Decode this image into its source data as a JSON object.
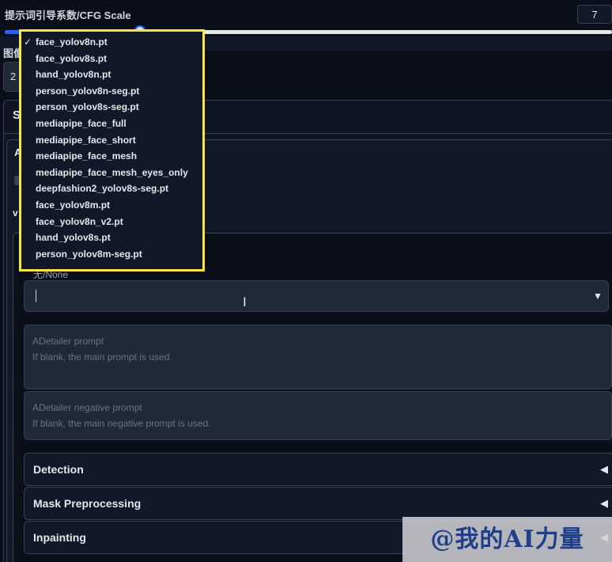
{
  "cfg": {
    "label": "提示词引导系数/CFG Scale",
    "value": "7",
    "fraction": 0.23
  },
  "partial": {
    "label": "图像",
    "box_text": "2",
    "tab": "S",
    "inner_a": "A",
    "inner_v": "v"
  },
  "model": {
    "none_label": "无/None",
    "selected": ""
  },
  "dropdown": {
    "checkmark": "✓",
    "items": [
      "face_yolov8n.pt",
      "face_yolov8s.pt",
      "hand_yolov8n.pt",
      "person_yolov8n-seg.pt",
      "person_yolov8s-seg.pt",
      "mediapipe_face_full",
      "mediapipe_face_short",
      "mediapipe_face_mesh",
      "mediapipe_face_mesh_eyes_only",
      "deepfashion2_yolov8s-seg.pt",
      "face_yolov8m.pt",
      "face_yolov8n_v2.pt",
      "hand_yolov8s.pt",
      "person_yolov8m-seg.pt"
    ],
    "selected_index": 0,
    "highlight_color": "#f5e642"
  },
  "prompts": {
    "positive": {
      "title": "ADetailer prompt",
      "placeholder": "If blank, the main prompt is used."
    },
    "negative": {
      "title": "ADetailer negative prompt",
      "placeholder": "If blank, the main negative prompt is used."
    }
  },
  "accordions": [
    {
      "label": "Detection"
    },
    {
      "label": "Mask Preprocessing"
    },
    {
      "label": "Inpainting"
    }
  ],
  "watermark": "@我的AI力量",
  "colors": {
    "background": "#0b0f19",
    "accent": "#2563eb"
  }
}
